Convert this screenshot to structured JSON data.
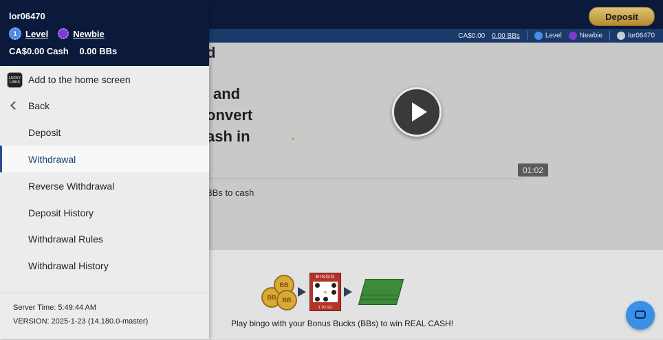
{
  "header": {
    "deposit_button": "Deposit",
    "status": {
      "cash": "CA$0.00",
      "bbs": "0.00 BBs",
      "level": "Level",
      "rank": "Newbie",
      "username": "lor06470"
    }
  },
  "drawer": {
    "username": "lor06470",
    "level_badge_number": "1",
    "level_label": "Level",
    "rank_label": "Newbie",
    "cash_balance": "CA$0.00 Cash",
    "bbs_balance": "0.00 BBs",
    "app_icon_text": "LUCKY LINKS",
    "items": [
      {
        "label": "Add to the home screen",
        "active": false
      },
      {
        "label": "Back",
        "active": false
      },
      {
        "label": "Deposit",
        "active": false
      },
      {
        "label": "Withdrawal",
        "active": true
      },
      {
        "label": "Reverse Withdrawal",
        "active": false
      },
      {
        "label": "Deposit History",
        "active": false
      },
      {
        "label": "Withdrawal Rules",
        "active": false
      },
      {
        "label": "Withdrawal History",
        "active": false
      }
    ],
    "footer": {
      "server_time": "Server Time: 5:49:44 AM",
      "version": "VERSION: 2025-1-23 (14.180.0-master)"
    }
  },
  "main": {
    "heading_lines": [
      "d",
      "and",
      "onvert",
      "ash in"
    ],
    "video_time": "01:02",
    "bbs_text": "BBs to cash",
    "promo_caption": "Play bingo with your Bonus Bucks (BBs) to win REAL CASH!",
    "bingo_header": "BINGO",
    "bingo_footer": "1 TO GO",
    "coin_label": "BB"
  },
  "colors": {
    "navy": "#0b1a3a",
    "status_blue": "#1a3a6a",
    "gold": "#c9a34a",
    "active_text": "#1e3f7a",
    "chat_blue": "#3a8fe6"
  }
}
